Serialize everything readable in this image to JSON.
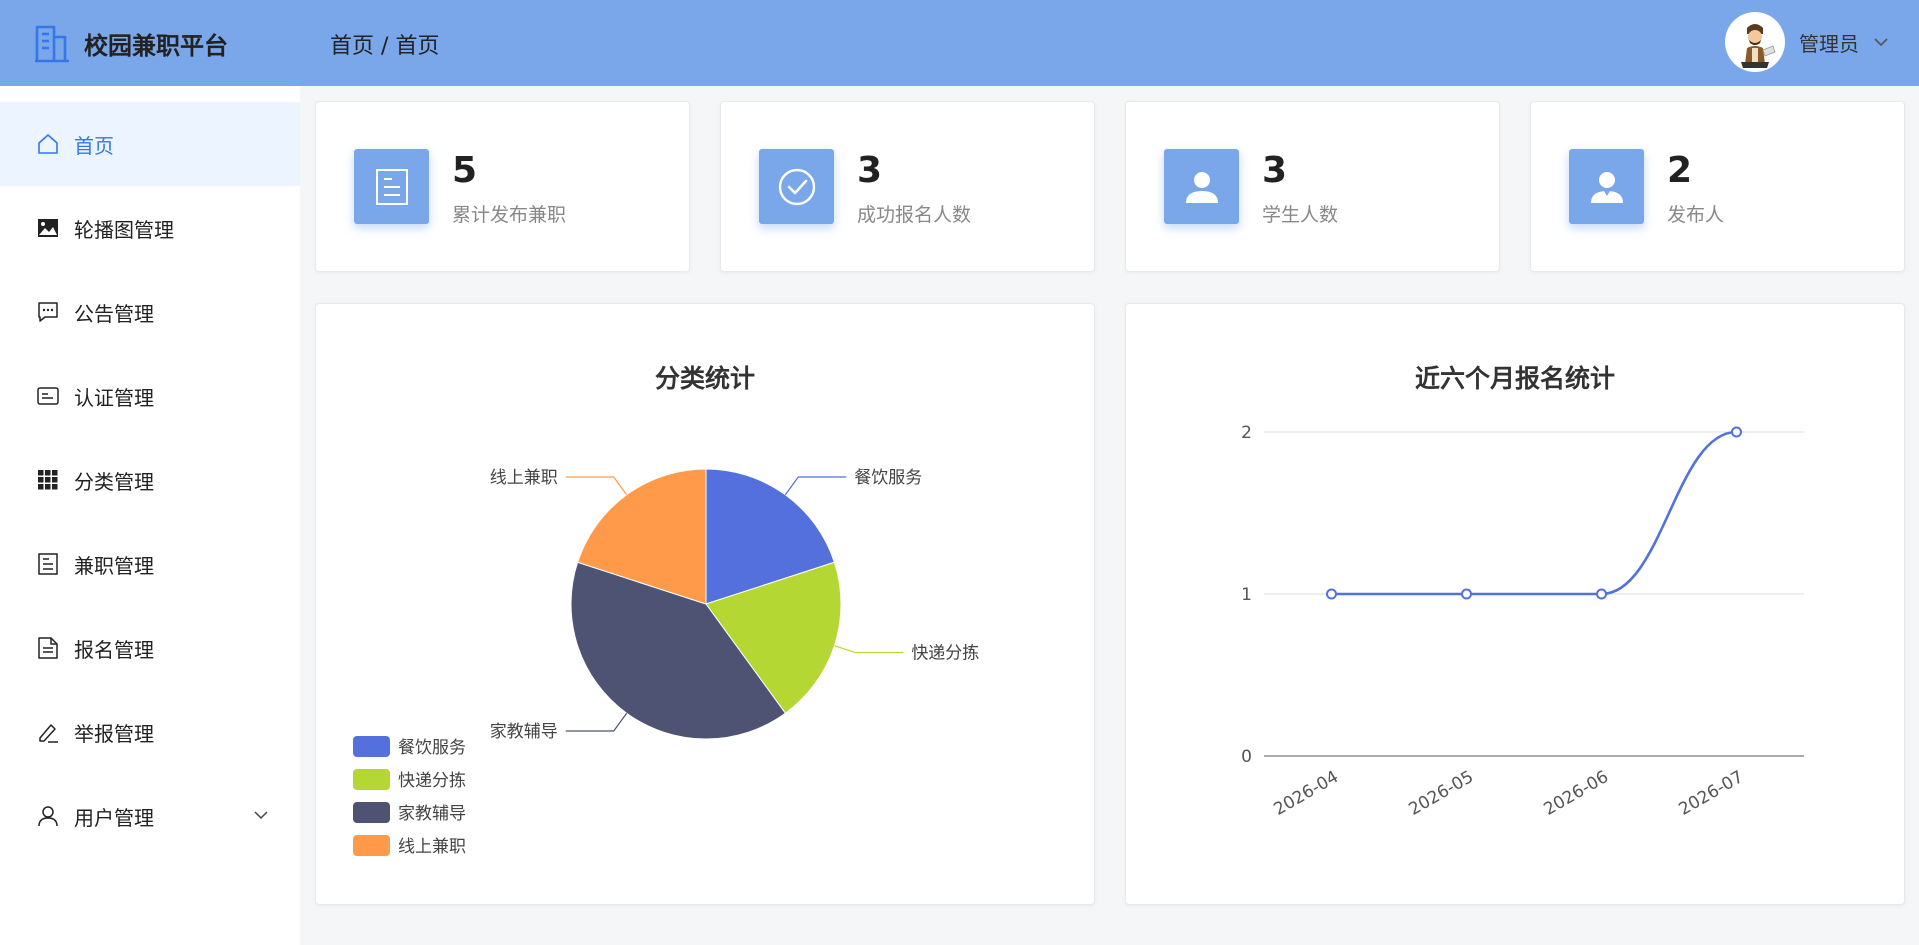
{
  "app": {
    "title": "校园兼职平台"
  },
  "breadcrumb": [
    "首页",
    "/",
    "首页"
  ],
  "user": {
    "name": "管理员"
  },
  "sidebar": {
    "items": [
      {
        "label": "首页",
        "icon": "home-icon",
        "active": true
      },
      {
        "label": "轮播图管理",
        "icon": "image-icon"
      },
      {
        "label": "公告管理",
        "icon": "message-icon"
      },
      {
        "label": "认证管理",
        "icon": "id-card-icon"
      },
      {
        "label": "分类管理",
        "icon": "grid-icon"
      },
      {
        "label": "兼职管理",
        "icon": "document-icon"
      },
      {
        "label": "报名管理",
        "icon": "file-icon"
      },
      {
        "label": "举报管理",
        "icon": "pen-icon"
      },
      {
        "label": "用户管理",
        "icon": "user-icon",
        "expandable": true
      }
    ]
  },
  "stats": [
    {
      "value": "5",
      "label": "累计发布兼职",
      "icon": "document-icon"
    },
    {
      "value": "3",
      "label": "成功报名人数",
      "icon": "check-circle-icon"
    },
    {
      "value": "3",
      "label": "学生人数",
      "icon": "user-icon"
    },
    {
      "value": "2",
      "label": "发布人",
      "icon": "user-icon"
    }
  ],
  "colors": {
    "accent": "#7aa6ea",
    "active_menu": "#3377e8",
    "pie": [
      "#5470dd",
      "#b5d734",
      "#4f5373",
      "#ff9a4a"
    ],
    "line": "#5470dd"
  },
  "chart_data": [
    {
      "type": "pie",
      "title": "分类统计",
      "categories": [
        "餐饮服务",
        "快递分拣",
        "家教辅导",
        "线上兼职"
      ],
      "values": [
        1,
        1,
        2,
        1
      ],
      "legend": "bottom-left"
    },
    {
      "type": "line",
      "title": "近六个月报名统计",
      "x": [
        "2026-04",
        "2026-05",
        "2026-06",
        "2026-07"
      ],
      "values": [
        1,
        1,
        1,
        2
      ],
      "ylim": [
        0,
        2
      ],
      "yticks": [
        0,
        1,
        2
      ],
      "smooth": true,
      "grid": true
    }
  ]
}
